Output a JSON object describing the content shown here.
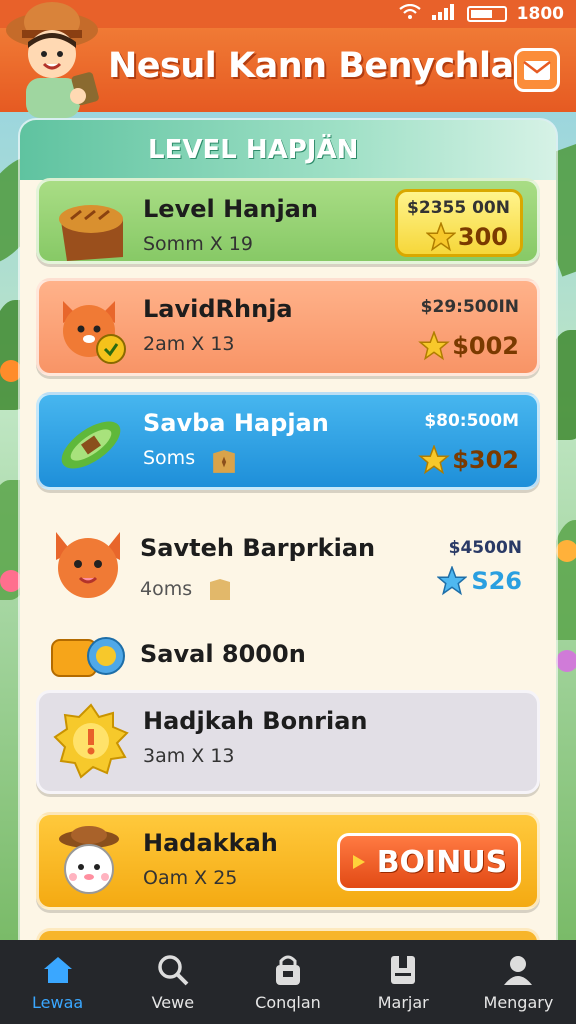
{
  "status_bar": {
    "time": "1800"
  },
  "header": {
    "title": "Nesul Kann Benychlan"
  },
  "panel": {
    "title": "LEVEL HAPJÄN"
  },
  "cards": [
    {
      "name": "Level Hanjan",
      "sub": "Somm X 19",
      "price": "$2355 00N",
      "coins": "300",
      "icon": "bread-loaf-icon",
      "color": "#a9dd85"
    },
    {
      "name": "LavidRhnja",
      "sub": "2am X 13",
      "price": "$29:500IN",
      "coins": "$002",
      "icon": "fox-icon",
      "color": "#ffb28a"
    },
    {
      "name": "Savba Hapjan",
      "sub": "Soms",
      "price": "$80:500M",
      "coins": "$302",
      "icon": "cucumber-icon",
      "color": "#1e8fd9"
    },
    {
      "name": "Savteh Barprkian",
      "sub": "4oms",
      "price": "$4500N",
      "coins": "S26",
      "icon": "fox-icon",
      "color": "#fdf6e6"
    },
    {
      "name": "Saval 8000n",
      "icon": "coin-bag-icon"
    },
    {
      "name": "Hadjkah Bonrian",
      "sub": "3am X 13",
      "icon": "sun-badge-icon",
      "color": "#e2dfe6"
    },
    {
      "name": "Hadakkah",
      "sub": "Oam X 25",
      "icon": "cat-farmer-icon",
      "color": "#f4aa12",
      "button": "BOINUS"
    }
  ],
  "nav": [
    {
      "label": "Lewaa",
      "icon": "home-icon",
      "active": true
    },
    {
      "label": "Vewe",
      "icon": "search-icon"
    },
    {
      "label": "Conqlan",
      "icon": "lock-bag-icon"
    },
    {
      "label": "Marjar",
      "icon": "notebook-icon"
    },
    {
      "label": "Mengary",
      "icon": "profile-icon"
    }
  ],
  "colors": {
    "accent": "#e8612a",
    "nav_active": "#3aa7ff"
  }
}
